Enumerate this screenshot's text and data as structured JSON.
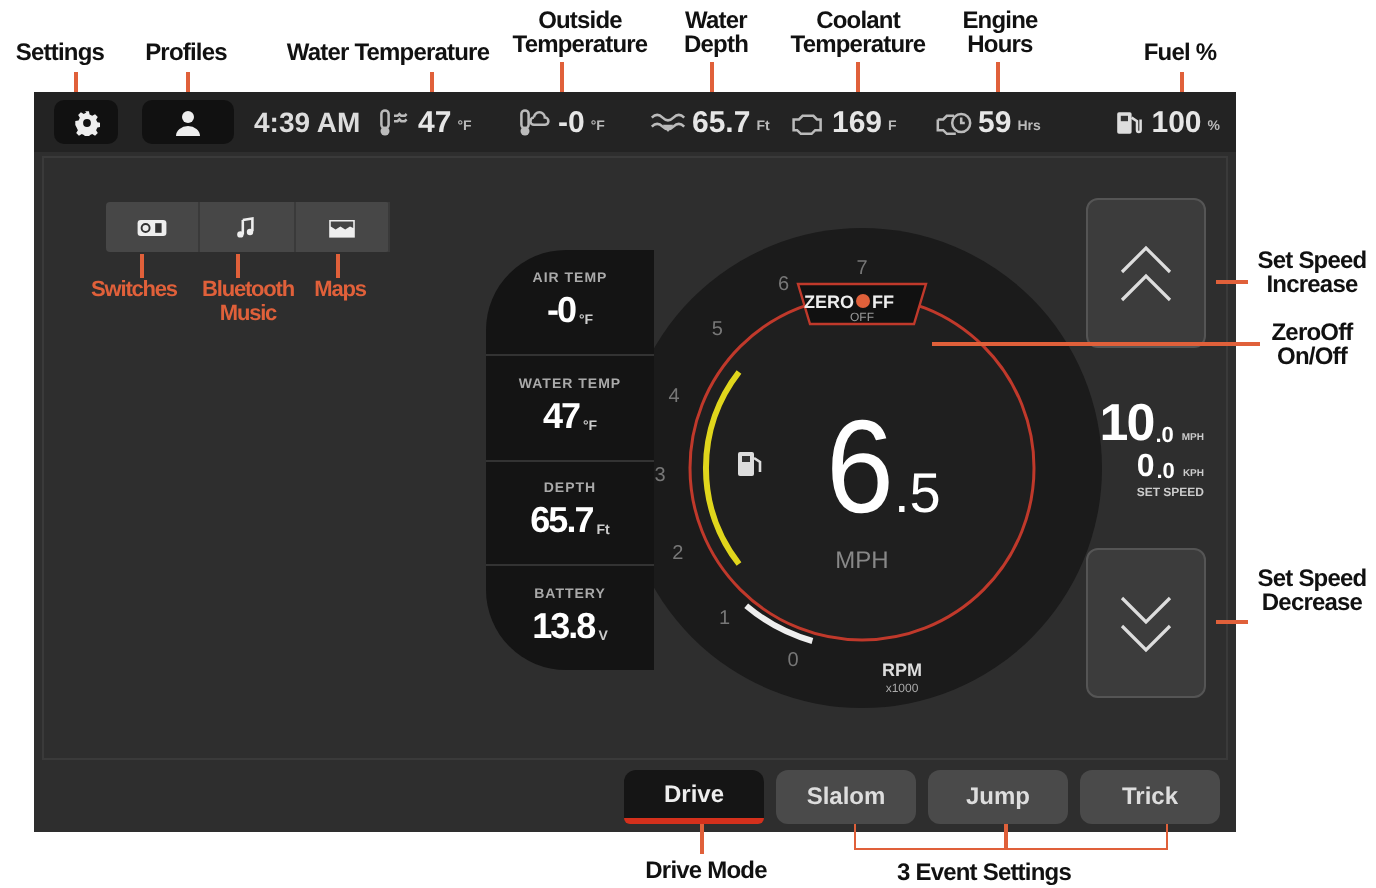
{
  "status_bar": {
    "time": "4:39 AM",
    "readings": [
      {
        "kind": "water-temp",
        "value": "47",
        "unit": "°F"
      },
      {
        "kind": "outside-temp",
        "value": "-0",
        "unit": "°F"
      },
      {
        "kind": "depth",
        "value": "65.7",
        "unit": "Ft"
      },
      {
        "kind": "coolant",
        "value": "169",
        "unit": "F"
      },
      {
        "kind": "engine-hours",
        "value": "59",
        "unit": "Hrs"
      },
      {
        "kind": "fuel",
        "value": "100",
        "unit": "%"
      }
    ]
  },
  "apps": [
    {
      "kind": "switches"
    },
    {
      "kind": "music"
    },
    {
      "kind": "maps"
    }
  ],
  "info_panel": [
    {
      "label": "AIR TEMP",
      "value": "-0",
      "unit": "°F"
    },
    {
      "label": "WATER TEMP",
      "value": "47",
      "unit": "°F"
    },
    {
      "label": "DEPTH",
      "value": "65.7",
      "unit": "Ft"
    },
    {
      "label": "BATTERY",
      "value": "13.8",
      "unit": "V"
    }
  ],
  "gauge": {
    "scale": [
      "0",
      "1",
      "2",
      "3",
      "4",
      "5",
      "6",
      "7"
    ],
    "speed_whole": "6",
    "speed_decimal": ".5",
    "speed_unit": "MPH",
    "rpm_label": "RPM",
    "rpm_multiplier": "x1000",
    "zero_off": {
      "logo_left": "ZERO",
      "logo_right": "FF",
      "state": "OFF"
    }
  },
  "set_speed": {
    "mph": "10",
    "mph_decimal": ".0",
    "mph_unit": "MPH",
    "kph": "0",
    "kph_decimal": ".0",
    "kph_unit": "KPH",
    "label": "SET SPEED"
  },
  "modes": [
    {
      "label": "Drive",
      "selected": true
    },
    {
      "label": "Slalom",
      "selected": false
    },
    {
      "label": "Jump",
      "selected": false
    },
    {
      "label": "Trick",
      "selected": false
    }
  ],
  "annotations": {
    "top": [
      "Settings",
      "Profiles",
      "Water Temperature",
      "Outside Temperature",
      "Water Depth",
      "Coolant Temperature",
      "Engine Hours",
      "Fuel %"
    ],
    "apps": [
      "Switches",
      "Bluetooth Music",
      "Maps"
    ],
    "right": [
      "Set Speed Increase",
      "ZeroOff On/Off",
      "Set Speed Decrease"
    ],
    "bottom": [
      "Drive Mode",
      "3 Event Settings"
    ]
  }
}
